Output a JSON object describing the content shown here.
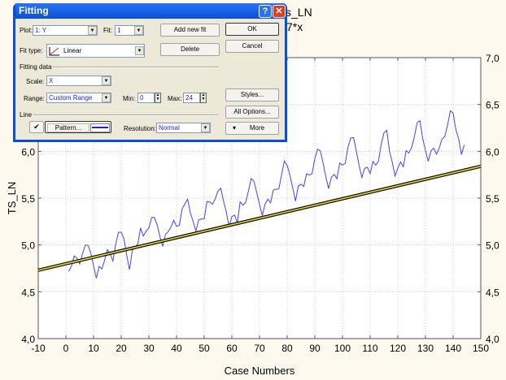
{
  "chart_title_visible": [
    "s_LN",
    "7*x"
  ],
  "dialog": {
    "title": "Fitting",
    "help_button": "?",
    "close_button": "✕",
    "plot_label": "Plot:",
    "plot_value": "1: Y",
    "fit_label": "Fit:",
    "fit_value": "1",
    "add_new_fit": "Add new fit",
    "ok": "OK",
    "cancel": "Cancel",
    "fit_type_label": "Fit type:",
    "fit_type_value": "Linear",
    "delete": "Delete",
    "fitting_data_label": "Fitting data",
    "scale_label": "Scale:",
    "scale_value": "X",
    "range_label": "Range:",
    "range_value": "Custom Range",
    "min_label": "Min:",
    "min_value": "0",
    "max_label": "Max:",
    "max_value": "24",
    "styles": "Styles...",
    "all_options": "All Options...",
    "line_label": "Line",
    "line_checked": true,
    "pattern": "Pattern...",
    "resolution_label": "Resolution:",
    "resolution_value": "Normal",
    "more": "More"
  },
  "chart_data": {
    "type": "line",
    "xlabel": "Case Numbers",
    "ylabel": "TS_LN",
    "xlim": [
      -10,
      150
    ],
    "ylim": [
      4.0,
      7.0
    ],
    "xticks": [
      "-10",
      "0",
      "10",
      "20",
      "30",
      "40",
      "50",
      "60",
      "70",
      "80",
      "90",
      "100",
      "110",
      "120",
      "130",
      "140",
      "150"
    ],
    "yticks": [
      "4,0",
      "4,5",
      "5,0",
      "5,5",
      "6,0",
      "6,5",
      "7,0"
    ],
    "grid": true,
    "series_color": "#4040ff",
    "fit_color": "#f0e000",
    "x_start": 1,
    "values": [
      4.718,
      4.771,
      4.883,
      4.86,
      4.796,
      4.905,
      4.997,
      4.997,
      4.913,
      4.779,
      4.644,
      4.771,
      4.745,
      4.836,
      4.949,
      4.905,
      4.828,
      5.004,
      5.136,
      5.136,
      5.063,
      4.89,
      4.736,
      4.942,
      4.977,
      5.011,
      5.182,
      5.094,
      5.147,
      5.182,
      5.293,
      5.293,
      5.215,
      5.088,
      4.984,
      5.112,
      5.142,
      5.193,
      5.263,
      5.198,
      5.209,
      5.384,
      5.438,
      5.489,
      5.342,
      5.252,
      5.147,
      5.268,
      5.278,
      5.278,
      5.464,
      5.46,
      5.434,
      5.493,
      5.576,
      5.606,
      5.468,
      5.352,
      5.193,
      5.303,
      5.318,
      5.236,
      5.46,
      5.425,
      5.455,
      5.576,
      5.71,
      5.68,
      5.557,
      5.434,
      5.313,
      5.434,
      5.489,
      5.451,
      5.587,
      5.595,
      5.598,
      5.753,
      5.897,
      5.849,
      5.743,
      5.613,
      5.468,
      5.628,
      5.649,
      5.624,
      5.759,
      5.746,
      5.762,
      5.924,
      6.023,
      6.004,
      5.872,
      5.724,
      5.602,
      5.724,
      5.753,
      5.707,
      5.875,
      5.852,
      5.872,
      6.045,
      6.142,
      6.146,
      6.001,
      5.849,
      5.72,
      5.817,
      5.829,
      5.762,
      5.892,
      5.852,
      5.894,
      6.075,
      6.197,
      6.225,
      6.001,
      5.883,
      5.737,
      5.82,
      5.886,
      5.835,
      6.006,
      5.981,
      6.04,
      6.157,
      6.306,
      6.326,
      6.138,
      6.009,
      5.892,
      6.004,
      6.033,
      5.969,
      6.038,
      6.133,
      6.157,
      6.282,
      6.433,
      6.407,
      6.23,
      6.133,
      5.966,
      6.068
    ],
    "fit_line": {
      "x": [
        -10,
        150
      ],
      "y": [
        4.73,
        5.84
      ]
    }
  }
}
